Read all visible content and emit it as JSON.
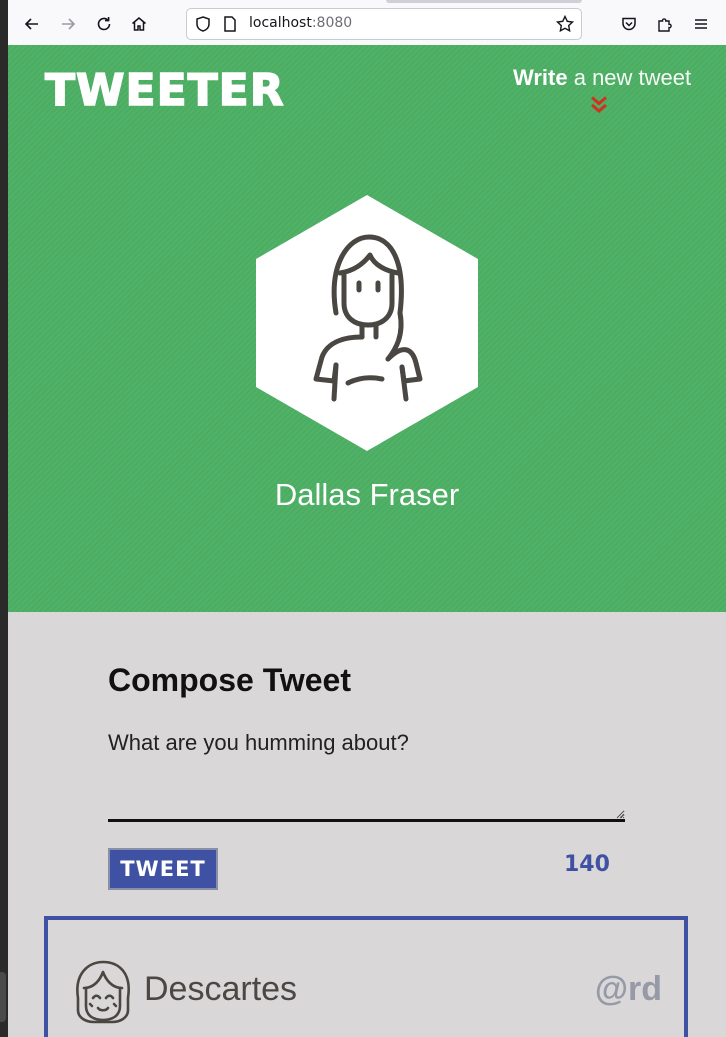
{
  "browser": {
    "url_host": "localhost",
    "url_port": ":8080"
  },
  "header": {
    "logo": "TWEETER",
    "write_bold": "Write",
    "write_rest": " a new tweet",
    "chevron_color": "#d0311e",
    "background": "#4caf64"
  },
  "profile": {
    "name": "Dallas Fraser"
  },
  "compose": {
    "title": "Compose Tweet",
    "placeholder": "What are you humming about?",
    "button_label": "TWEET",
    "counter": "140",
    "accent": "#3f51a3"
  },
  "tweets": [
    {
      "name": "Descartes",
      "handle": "@rd"
    }
  ]
}
